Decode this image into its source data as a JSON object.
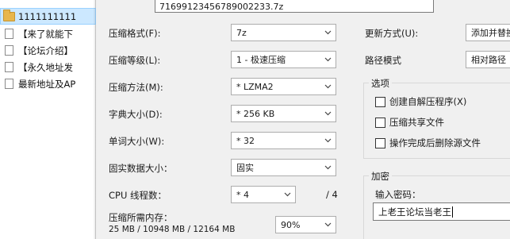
{
  "file_list": {
    "items": [
      {
        "label": "1111111111",
        "icon": "folder-icon",
        "selected": true
      },
      {
        "label": "【来了就能下",
        "icon": "document-icon"
      },
      {
        "label": "【论坛介绍】",
        "icon": "document-icon"
      },
      {
        "label": "【永久地址发",
        "icon": "document-icon"
      },
      {
        "label": "最新地址及AP",
        "icon": "document-icon"
      }
    ]
  },
  "dialog": {
    "archive_name": "71699123456789002233.7z",
    "format": {
      "label": "压缩格式(F):",
      "value": "7z"
    },
    "level": {
      "label": "压缩等级(L):",
      "value": "1 - 极速压缩"
    },
    "method": {
      "label": "压缩方法(M):",
      "value": "* LZMA2"
    },
    "dict_size": {
      "label": "字典大小(D):",
      "value": "* 256 KB"
    },
    "word_size": {
      "label": "单词大小(W):",
      "value": "* 32"
    },
    "solid_size": {
      "label": "固实数据大小：",
      "value": "固实"
    },
    "cpu_threads": {
      "label": "CPU 线程数：",
      "value": "* 4",
      "max": "/ 4"
    },
    "memory": {
      "label": "压缩所需内存：",
      "value": "25 MB / 10948 MB / 12164 MB",
      "percent": "90%"
    },
    "update_mode": {
      "label": "更新方式(U):",
      "value": "添加并替换"
    },
    "path_mode": {
      "label": "路径模式",
      "value": "相对路径"
    },
    "options": {
      "title": "选项",
      "create_sfx": "创建自解压程序(X)",
      "compress_shared": "压缩共享文件",
      "delete_after": "操作完成后删除源文件"
    },
    "encryption": {
      "title": "加密",
      "password_label": "输入密码：",
      "password_value": "上老王论坛当老王"
    }
  }
}
